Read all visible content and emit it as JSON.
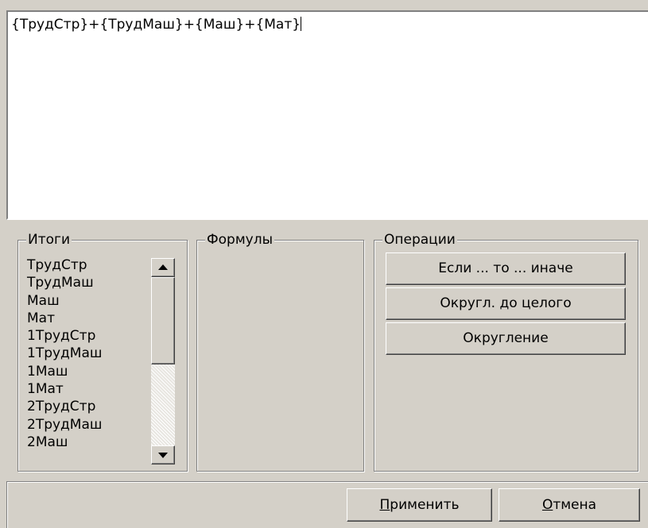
{
  "formula": {
    "text": "{ТрудСтр}+{ТрудМаш}+{Маш}+{Мат}"
  },
  "itogi": {
    "title": "Итоги",
    "items": [
      "ТрудСтр",
      "ТрудМаш",
      "Маш",
      "Мат",
      "1ТрудСтр",
      "1ТрудМаш",
      "1Маш",
      "1Мат",
      "2ТрудСтр",
      "2ТрудМаш",
      "2Маш"
    ]
  },
  "formuly": {
    "title": "Формулы"
  },
  "operacii": {
    "title": "Операции",
    "buttons": [
      "Если ... то ... иначе",
      "Округл. до целого",
      "Округление"
    ]
  },
  "dialog": {
    "apply": {
      "mnemonic": "П",
      "rest": "рименить"
    },
    "cancel": {
      "mnemonic": "О",
      "rest": "тмена"
    }
  },
  "icons": {
    "scroll_up": "arrow-up-icon",
    "scroll_down": "arrow-down-icon"
  }
}
